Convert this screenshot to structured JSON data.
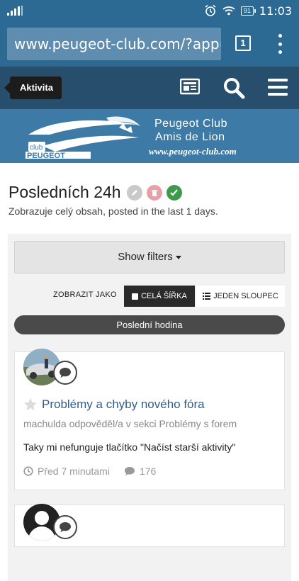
{
  "status_bar": {
    "time": "11:03",
    "battery": "91",
    "icons": [
      "signal-icon",
      "alarm-icon",
      "wifi-icon",
      "battery-icon"
    ]
  },
  "browser": {
    "url": "www.peugeot-club.com/?app=c",
    "tab_count": "1"
  },
  "site_header": {
    "activity_label": "Aktivita",
    "icons": [
      "stream-icon",
      "search-icon",
      "menu-icon"
    ]
  },
  "banner": {
    "logo_text_club": "club",
    "logo_text_brand": "PEUGEOT",
    "title": "Peugeot Club",
    "subtitle": "Amis de Lion",
    "url": "www.peugeot-club.com"
  },
  "page": {
    "title": "Posledních 24h",
    "subtitle": "Zobrazuje celý obsah, posted in the last 1 days."
  },
  "filters": {
    "show_filters": "Show filters",
    "view_as": "ZOBRAZIT JAKO",
    "full_width": "CELÁ ŠÍŘKA",
    "single_column": "JEDEN SLOUPEC",
    "period": "Poslední hodina"
  },
  "items": [
    {
      "title": "Problémy a chyby nového fóra",
      "meta": "machulda odpověděl/a v sekci Problémy s forem",
      "snippet": "Taky mi nefunguje tlačítko \"Načíst starší aktivity\"",
      "time": "Před 7 minutami",
      "replies": "176"
    }
  ],
  "colors": {
    "status_bar": "#2c6a94",
    "site_header": "#274e6c",
    "banner": "#3d7aa6",
    "link": "#2e5f8a",
    "check_green": "#3c9a4a",
    "delete_pink": "#e8a0a8"
  }
}
